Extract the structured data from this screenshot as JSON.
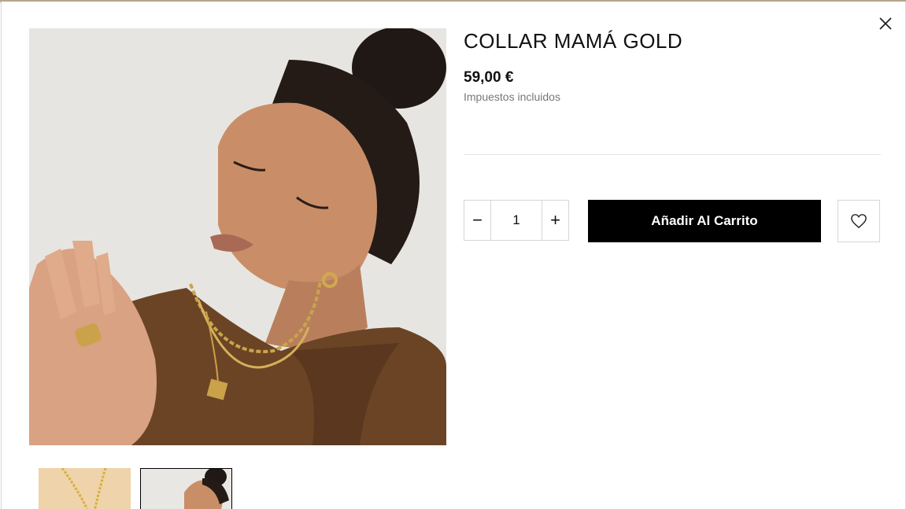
{
  "product": {
    "title": "COLLAR MAMÁ GOLD",
    "price": "59,00 €",
    "tax_note": "Impuestos incluidos"
  },
  "quantity": {
    "value": "1",
    "decrement_icon": "minus-icon",
    "increment_icon": "plus-icon",
    "decrement_glyph": "−",
    "increment_glyph": "+"
  },
  "actions": {
    "add_to_cart_label": "Añadir Al Carrito",
    "wishlist_icon": "heart-icon",
    "close_icon": "close-icon"
  },
  "gallery": {
    "main_image": "woman-wearing-gold-necklaces-photo",
    "thumbnails": [
      "gold-necklace-on-beige-photo",
      "woman-wearing-gold-necklaces-photo"
    ],
    "selected_thumbnail": 2
  },
  "colors": {
    "button_bg": "#000000",
    "button_text": "#ffffff",
    "shirt_brown": "#6b4426",
    "thumb_beige": "#efd3aa"
  }
}
